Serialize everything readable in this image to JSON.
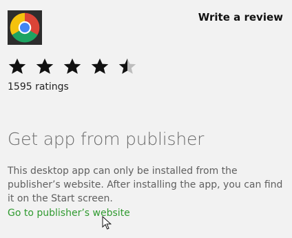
{
  "app": {
    "name": "Google Chrome",
    "icon": "chrome-icon"
  },
  "header": {
    "write_review_label": "Write a review"
  },
  "rating": {
    "value": 4.5,
    "max": 5,
    "count_text": "1595 ratings",
    "star_color": "#111111",
    "empty_star_color": "#bdbdbd"
  },
  "publisher": {
    "title": "Get app from publisher",
    "description": "This desktop app can only be installed from the publisher’s website. After installing the app, you can find it on the Start screen.",
    "link_label": "Go to publisher’s website",
    "link_color": "#2f9a2f"
  },
  "cursor": {
    "icon": "arrow-cursor-icon"
  }
}
